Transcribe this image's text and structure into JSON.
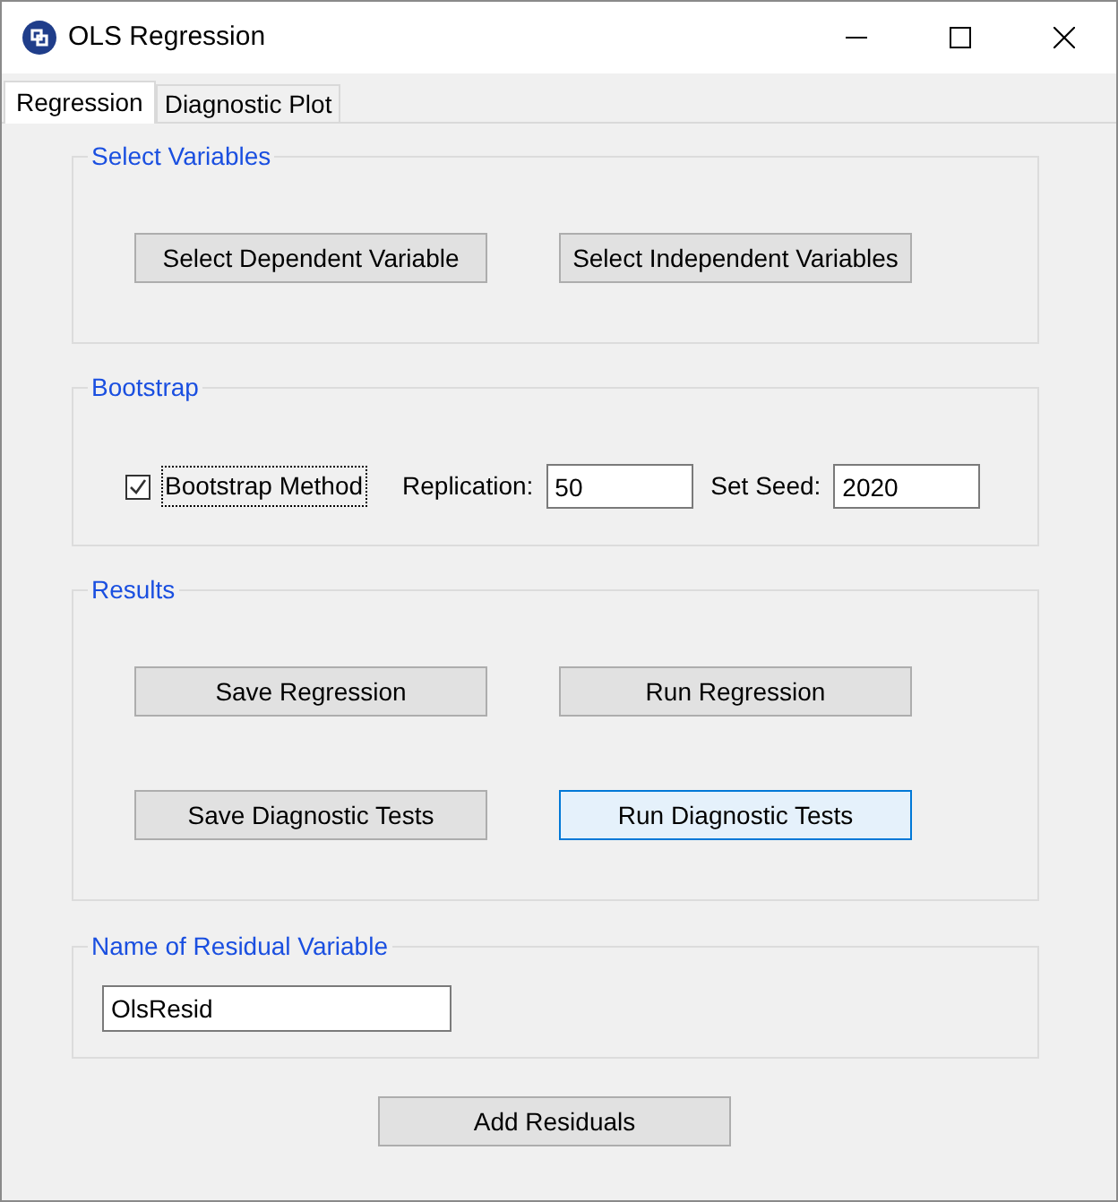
{
  "window": {
    "title": "OLS Regression"
  },
  "tabs": [
    {
      "label": "Regression",
      "selected": true
    },
    {
      "label": "Diagnostic Plot",
      "selected": false
    }
  ],
  "groups": [
    {
      "kind": "buttons",
      "title": "Select Variables",
      "rows": [
        [
          {
            "label": "Select Dependent Variable",
            "highlighted": false
          },
          {
            "label": "Select Independent Variables",
            "highlighted": false
          }
        ]
      ]
    },
    {
      "kind": "bootstrap",
      "title": "Bootstrap",
      "checkbox": {
        "label": "Bootstrap Method",
        "checked": true
      },
      "fields": [
        {
          "label": "Replication:",
          "value": "50"
        },
        {
          "label": "Set Seed:",
          "value": "2020"
        }
      ]
    },
    {
      "kind": "buttons",
      "title": "Results",
      "rows": [
        [
          {
            "label": "Save Regression",
            "highlighted": false
          },
          {
            "label": "Run Regression",
            "highlighted": false
          }
        ],
        [
          {
            "label": "Save Diagnostic Tests",
            "highlighted": false
          },
          {
            "label": "Run Diagnostic Tests",
            "highlighted": true
          }
        ]
      ]
    },
    {
      "kind": "field",
      "title": "Name of Residual Variable",
      "value": "OlsResid"
    }
  ],
  "footer_button": {
    "label": "Add Residuals"
  }
}
